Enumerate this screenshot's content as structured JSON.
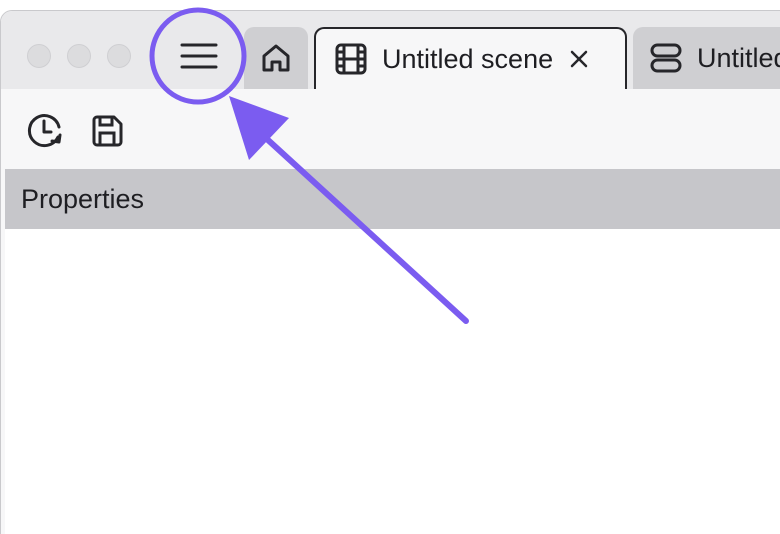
{
  "window": {
    "traffic_lights": [
      "close",
      "minimize",
      "zoom"
    ]
  },
  "menu": {
    "icon": "hamburger-menu-icon",
    "highlighted": true
  },
  "tabs": [
    {
      "icon": "home-icon",
      "label": "",
      "active": false
    },
    {
      "icon": "film-icon",
      "label": "Untitled scene",
      "active": true,
      "closable": true
    },
    {
      "icon": "layers-icon",
      "label": "Untitled",
      "active": false
    }
  ],
  "toolbar": {
    "items": [
      "history-icon",
      "save-icon"
    ]
  },
  "panel": {
    "title": "Properties"
  },
  "annotation": {
    "color": "#7b5cf0",
    "type": "arrow pointing to menu button"
  }
}
